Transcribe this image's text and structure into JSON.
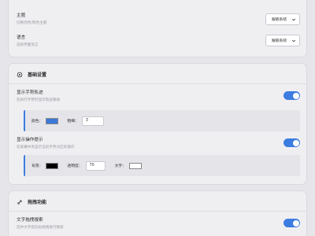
{
  "appearance": {
    "theme": {
      "title": "主题",
      "desc": "切换亮色/暗色主题",
      "value": "跟随系统"
    },
    "language": {
      "title": "语言",
      "desc": "选择界面语言",
      "value": "跟随系统"
    }
  },
  "basic": {
    "header": "基础设置",
    "trail": {
      "title": "显示手势轨迹",
      "desc": "在执行手势时显示轨迹路线",
      "enabled": true,
      "color_label": "颜色：",
      "color": "#3c78d8",
      "width_label": "粗细：",
      "width": "3"
    },
    "hint": {
      "title": "显示操作提示",
      "desc": "在屏幕中央显示当前手势对应的操作",
      "enabled": true,
      "bg_label": "背景：",
      "bg_color": "#000000",
      "opacity_label": "透明度：",
      "opacity": "70",
      "text_label": "文字：",
      "text_color": "#ffffff"
    }
  },
  "drag": {
    "header": "拖拽功能",
    "text_search": {
      "title": "文字拖拽搜索",
      "desc": "选中文字后向右拖拽进行搜索",
      "enabled": true
    }
  },
  "colors": {
    "accent": "#3d7ce0",
    "card": "#efeff2",
    "background": "#e6e6ea"
  },
  "icons": {
    "basic_header": "gear-icon",
    "drag_header": "link-icon",
    "select_arrow": "chevron-down-icon"
  }
}
